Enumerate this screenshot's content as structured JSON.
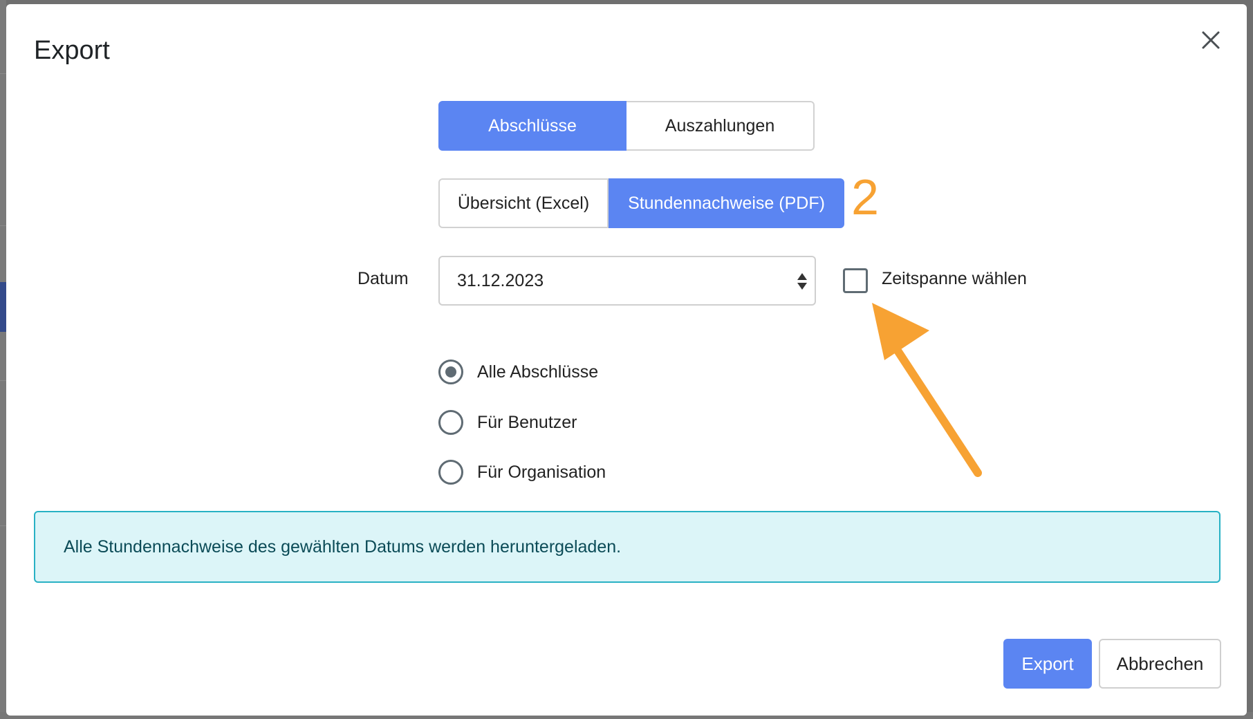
{
  "dialog": {
    "title": "Export",
    "close_icon": "close-icon"
  },
  "export_type_tabs": [
    {
      "label": "Abschlüsse",
      "active": true
    },
    {
      "label": "Auszahlungen",
      "active": false
    }
  ],
  "format_tabs": [
    {
      "label": "Übersicht (Excel)",
      "active": false
    },
    {
      "label": "Stundennachweise (PDF)",
      "active": true
    }
  ],
  "annotation": {
    "step_number": "2",
    "color": "#f7a233",
    "arrow_icon": "arrow-pointer-icon"
  },
  "date": {
    "label": "Datum",
    "value": "31.12.2023"
  },
  "timespan_checkbox": {
    "label": "Zeitspanne wählen",
    "checked": false
  },
  "scope_options": [
    {
      "label": "Alle Abschlüsse",
      "checked": true
    },
    {
      "label": "Für Benutzer",
      "checked": false
    },
    {
      "label": "Für Organisation",
      "checked": false
    }
  ],
  "info_alert": {
    "text": "Alle Stundennachweise des gewählten Datums werden heruntergeladen."
  },
  "footer": {
    "export_label": "Export",
    "cancel_label": "Abbrechen"
  },
  "colors": {
    "primary": "#5b85f2",
    "info_bg": "#dcf5f8",
    "info_border": "#28b1c4",
    "info_text": "#0b4b57"
  }
}
